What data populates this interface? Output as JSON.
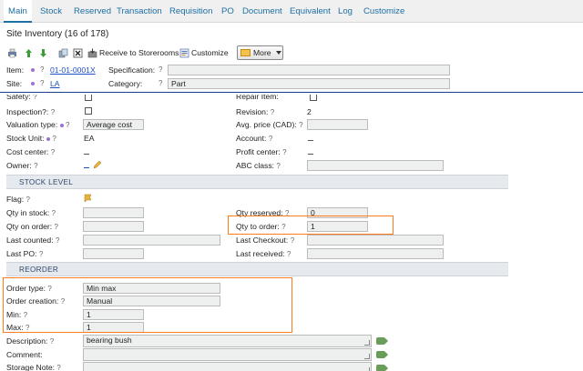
{
  "tabs": [
    {
      "label": "Main",
      "active": true
    },
    {
      "label": "Stock"
    },
    {
      "label": "Reserved"
    },
    {
      "label": "Transaction"
    },
    {
      "label": "Requisition"
    },
    {
      "label": "PO"
    },
    {
      "label": "Document"
    },
    {
      "label": "Equivalent"
    },
    {
      "label": "Log"
    },
    {
      "label": "Customize"
    }
  ],
  "page_title": "Site Inventory (16 of 178)",
  "toolbar": {
    "receive_label": "Receive to Storerooms",
    "customize_label": "Customize",
    "more_label": "More"
  },
  "help": "?",
  "header": {
    "item_label": "Item:",
    "item_value": "01-01-0001X",
    "site_label": "Site:",
    "site_value": "LA",
    "specification_label": "Specification:",
    "specification_value": "",
    "category_label": "Category:",
    "category_value": "Part"
  },
  "general": {
    "safety_label": "Safety:",
    "repair_item_label": "Repair Item:",
    "inspection_label": "Inspection?:",
    "revision_label": "Revision:",
    "revision_value": "2",
    "valuation_type_label": "Valuation type:",
    "valuation_type_value": "Average cost",
    "avg_price_label": "Avg. price (CAD):",
    "avg_price_value": "",
    "stock_unit_label": "Stock Unit:",
    "stock_unit_value": "EA",
    "account_label": "Account:",
    "cost_center_label": "Cost center:",
    "profit_center_label": "Profit center:",
    "owner_label": "Owner:",
    "abc_class_label": "ABC class:",
    "abc_class_value": ""
  },
  "stock_level": {
    "section_title": "STOCK LEVEL",
    "flag_label": "Flag:",
    "qty_in_stock_label": "Qty in stock:",
    "qty_in_stock_value": "",
    "qty_reserved_label": "Qty reserved:",
    "qty_reserved_value": "0",
    "qty_on_order_label": "Qty on order:",
    "qty_on_order_value": "",
    "qty_to_order_label": "Qty to order:",
    "qty_to_order_value": "1",
    "last_counted_label": "Last counted:",
    "last_counted_value": "",
    "last_checkout_label": "Last Checkout:",
    "last_checkout_value": "",
    "last_po_label": "Last PO:",
    "last_po_value": "",
    "last_received_label": "Last received:",
    "last_received_value": ""
  },
  "reorder": {
    "section_title": "REORDER",
    "order_type_label": "Order type:",
    "order_type_value": "Min max",
    "order_creation_label": "Order creation:",
    "order_creation_value": "Manual",
    "min_label": "Min:",
    "min_value": "1",
    "max_label": "Max:",
    "max_value": "1"
  },
  "notes": {
    "description_label": "Description:",
    "description_value": "bearing bush",
    "comment_label": "Comment:",
    "comment_value": "",
    "storage_note_label": "Storage Note:",
    "storage_note_value": ""
  },
  "colors": {
    "link": "#1d6fa5",
    "highlight": "#ff7a1a",
    "divider": "#1a3e8c",
    "required_dot": "#a06fd0"
  }
}
